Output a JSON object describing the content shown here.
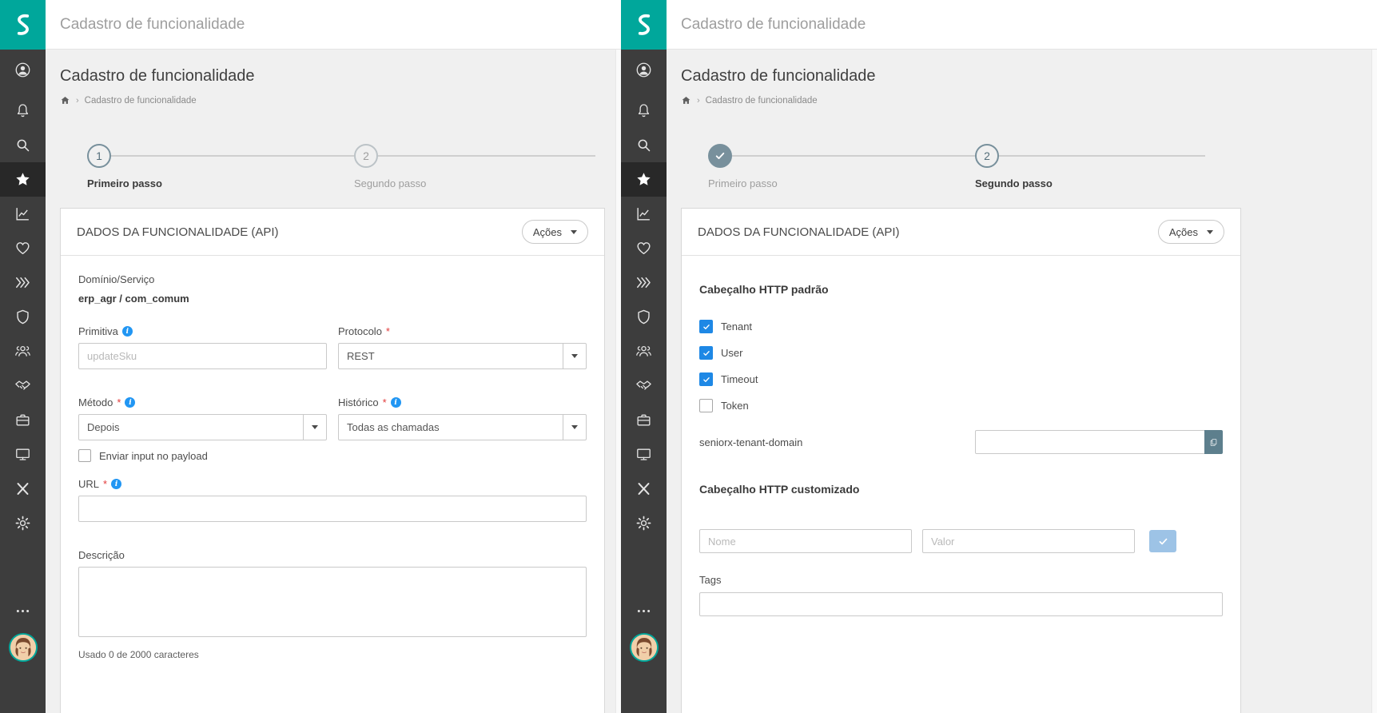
{
  "app": {
    "topbar_title": "Cadastro de funcionalidade",
    "page_title": "Cadastro de funcionalidade",
    "breadcrumb_item": "Cadastro de funcionalidade"
  },
  "stepper": {
    "step1_number": "1",
    "step1_label": "Primeiro passo",
    "step2_number": "2",
    "step2_label": "Segundo passo"
  },
  "windows": {
    "left": {
      "current_step": 1,
      "completed_steps": []
    },
    "right": {
      "current_step": 2,
      "completed_steps": [
        1
      ]
    }
  },
  "card": {
    "title": "DADOS DA FUNCIONALIDADE (API)",
    "actions_label": "Ações"
  },
  "step1_form": {
    "dominio": {
      "label": "Domínio/Serviço",
      "value": "erp_agr / com_comum"
    },
    "primitiva": {
      "label": "Primitiva",
      "placeholder": "updateSku",
      "value": ""
    },
    "protocolo": {
      "label": "Protocolo",
      "value": "REST",
      "required": true
    },
    "metodo": {
      "label": "Método",
      "value": "Depois",
      "required": true
    },
    "historico": {
      "label": "Histórico",
      "value": "Todas as chamadas",
      "required": true
    },
    "payload_checkbox": {
      "label": "Enviar input no payload",
      "checked": false
    },
    "url": {
      "label": "URL",
      "required": true,
      "value": ""
    },
    "descricao": {
      "label": "Descrição",
      "value": "",
      "counter": "Usado 0 de 2000 caracteres"
    }
  },
  "step2_form": {
    "default_header_title": "Cabeçalho HTTP padrão",
    "checkboxes": [
      {
        "label": "Tenant",
        "checked": true
      },
      {
        "label": "User",
        "checked": true
      },
      {
        "label": "Timeout",
        "checked": true
      },
      {
        "label": "Token",
        "checked": false
      }
    ],
    "tenant_domain": {
      "label": "seniorx-tenant-domain",
      "value": ""
    },
    "custom_header_title": "Cabeçalho HTTP customizado",
    "custom_name_placeholder": "Nome",
    "custom_value_placeholder": "Valor",
    "tags_label": "Tags",
    "tags_value": ""
  },
  "sidebar": {
    "items": [
      "account",
      "notifications",
      "search",
      "favorites",
      "analytics",
      "health",
      "shortcuts",
      "security",
      "people",
      "partners",
      "jobs",
      "workstation",
      "close-x",
      "settings",
      "more",
      "user-avatar"
    ],
    "active_item": "favorites"
  },
  "icons": {
    "breadcrumb_home": "home-icon",
    "dropdown": "chevron-down-icon",
    "step_done": "check-icon",
    "tenant_copy": "copy-icon",
    "confirm": "check-icon"
  },
  "colors": {
    "brand_teal": "#00a79b",
    "sidebar_bg": "#3d3d3d",
    "sidebar_active_bg": "#282828",
    "step_slate": "#78909c",
    "checkbox_blue": "#1e88e5",
    "info_blue": "#2196f3",
    "required_red": "#e23b3b",
    "confirm_button_blue": "#9dc3e6",
    "copy_button_slate": "#5d7f8d",
    "background_gray": "#f0f0f0"
  }
}
